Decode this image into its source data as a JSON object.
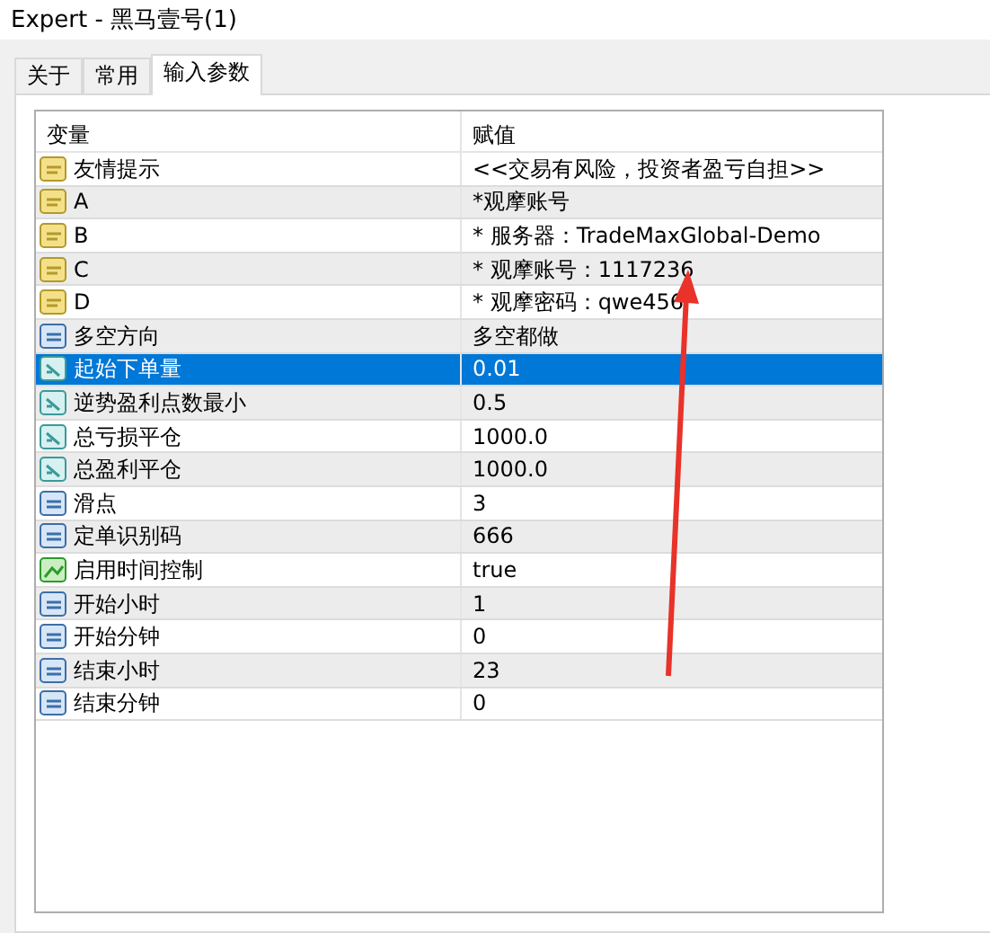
{
  "window": {
    "title": "Expert - 黑马壹号(1)"
  },
  "tabs": [
    {
      "label": "关于",
      "selected": false
    },
    {
      "label": "常用",
      "selected": false
    },
    {
      "label": "输入参数",
      "selected": true
    }
  ],
  "table": {
    "columns": [
      "变量",
      "赋值"
    ],
    "rows": [
      {
        "kind": "string",
        "name": "友情提示",
        "value": "<<交易有风险，投资者盈亏自担>>",
        "selected": false
      },
      {
        "kind": "string",
        "name": "A",
        "value": "*观摩账号",
        "selected": false
      },
      {
        "kind": "string",
        "name": "B",
        "value": "* 服务器：TradeMaxGlobal-Demo",
        "selected": false
      },
      {
        "kind": "string",
        "name": "C",
        "value": "* 观摩账号：1117236",
        "selected": false
      },
      {
        "kind": "string",
        "name": "D",
        "value": "* 观摩密码：qwe456",
        "selected": false
      },
      {
        "kind": "int",
        "name": "多空方向",
        "value": "多空都做",
        "selected": false
      },
      {
        "kind": "double",
        "name": "起始下单量",
        "value": "0.01",
        "selected": true
      },
      {
        "kind": "double",
        "name": "逆势盈利点数最小",
        "value": "0.5",
        "selected": false
      },
      {
        "kind": "double",
        "name": "总亏损平仓",
        "value": "1000.0",
        "selected": false
      },
      {
        "kind": "double",
        "name": "总盈利平仓",
        "value": "1000.0",
        "selected": false
      },
      {
        "kind": "int",
        "name": "滑点",
        "value": "3",
        "selected": false
      },
      {
        "kind": "int",
        "name": "定单识别码",
        "value": "666",
        "selected": false
      },
      {
        "kind": "bool",
        "name": "启用时间控制",
        "value": "true",
        "selected": false
      },
      {
        "kind": "int",
        "name": "开始小时",
        "value": "1",
        "selected": false
      },
      {
        "kind": "int",
        "name": "开始分钟",
        "value": "0",
        "selected": false
      },
      {
        "kind": "int",
        "name": "结束小时",
        "value": "23",
        "selected": false
      },
      {
        "kind": "int",
        "name": "结束分钟",
        "value": "0",
        "selected": false
      }
    ]
  }
}
